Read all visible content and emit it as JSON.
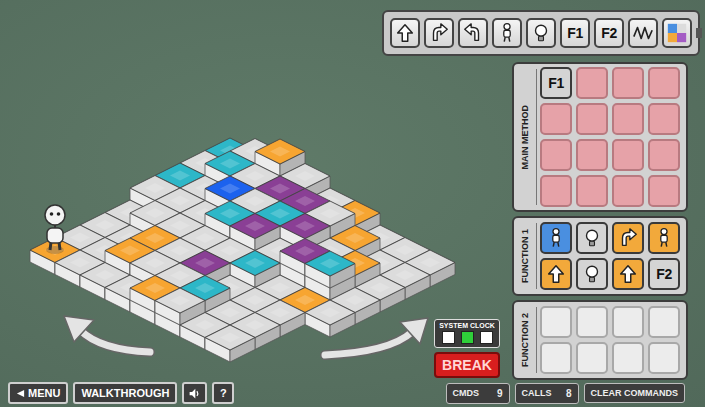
{
  "toolbar": [
    {
      "kind": "forward"
    },
    {
      "kind": "turn-right"
    },
    {
      "kind": "turn-left"
    },
    {
      "kind": "jump"
    },
    {
      "kind": "light"
    },
    {
      "kind": "call",
      "label": "F1"
    },
    {
      "kind": "call",
      "label": "F2"
    },
    {
      "kind": "zigzag"
    },
    {
      "kind": "colors"
    }
  ],
  "panels": [
    {
      "title": "MAIN METHOD",
      "kind": "main",
      "slots": [
        {
          "kind": "call",
          "label": "F1",
          "color": "#d4d4d4"
        },
        {
          "kind": "empty"
        },
        {
          "kind": "empty"
        },
        {
          "kind": "empty"
        },
        {
          "kind": "empty"
        },
        {
          "kind": "empty"
        },
        {
          "kind": "empty"
        },
        {
          "kind": "empty"
        },
        {
          "kind": "empty"
        },
        {
          "kind": "empty"
        },
        {
          "kind": "empty"
        },
        {
          "kind": "empty"
        },
        {
          "kind": "empty"
        },
        {
          "kind": "empty"
        },
        {
          "kind": "empty"
        },
        {
          "kind": "empty"
        }
      ]
    },
    {
      "title": "FUNCTION 1",
      "kind": "function",
      "slots": [
        {
          "kind": "jump",
          "color": "#4a8fe0"
        },
        {
          "kind": "light",
          "color": "#d4d4d4"
        },
        {
          "kind": "turn-right",
          "color": "#f2a93b"
        },
        {
          "kind": "jump",
          "color": "#f2a93b"
        },
        {
          "kind": "forward",
          "color": "#f2a93b"
        },
        {
          "kind": "light",
          "color": "#d4d4d4"
        },
        {
          "kind": "forward",
          "color": "#f2a93b"
        },
        {
          "kind": "call",
          "label": "F2",
          "color": "#d4d4d4"
        }
      ]
    },
    {
      "title": "FUNCTION 2",
      "kind": "function",
      "slots": [
        {
          "kind": "empty"
        },
        {
          "kind": "empty"
        },
        {
          "kind": "empty"
        },
        {
          "kind": "empty"
        },
        {
          "kind": "empty"
        },
        {
          "kind": "empty"
        },
        {
          "kind": "empty"
        },
        {
          "kind": "empty"
        }
      ]
    }
  ],
  "board": {
    "rows": [
      [
        {
          "h": 2,
          "color": "#2db7c8"
        },
        {
          "h": 3,
          "color": "#dcdcdc"
        },
        {
          "h": 4,
          "color": "#f7a531"
        },
        {
          "h": 3,
          "color": "#dcdcdc"
        },
        {
          "h": 2,
          "color": "#dcdcdc"
        },
        {
          "h": 2,
          "color": "#f7a531"
        },
        {
          "h": 1,
          "color": "#dcdcdc"
        },
        {
          "h": 1,
          "color": "#dcdcdc"
        },
        {
          "h": 1,
          "color": "#dcdcdc"
        }
      ],
      [
        {
          "h": 2,
          "color": "#dcdcdc"
        },
        {
          "h": 3,
          "color": "#2db7c8"
        },
        {
          "h": 3,
          "color": "#dcdcdc"
        },
        {
          "h": 3,
          "color": "#8a3f95"
        },
        {
          "h": 3,
          "color": "#8a3f95"
        },
        {
          "h": 3,
          "color": "#dcdcdc"
        },
        {
          "h": 2,
          "color": "#f7a531"
        },
        {
          "h": 1,
          "color": "#dcdcdc"
        },
        {
          "h": 1,
          "color": "#dcdcdc"
        }
      ],
      [
        {
          "h": 2,
          "color": "#2db7c8"
        },
        {
          "h": 2,
          "color": "#dcdcdc"
        },
        {
          "h": 3,
          "color": "#1c62ee"
        },
        {
          "h": 3,
          "color": "#dcdcdc"
        },
        {
          "h": 3,
          "color": "#2db7c8"
        },
        {
          "h": 3,
          "color": "#8a3f95"
        },
        {
          "h": 2,
          "color": "#dcdcdc"
        },
        {
          "h": 2,
          "color": "#f7a531"
        },
        {
          "h": 1,
          "color": "#dcdcdc"
        }
      ],
      [
        {
          "h": 2,
          "color": "#dcdcdc"
        },
        {
          "h": 2,
          "color": "#dcdcdc"
        },
        {
          "h": 2,
          "color": "#dcdcdc"
        },
        {
          "h": 3,
          "color": "#2db7c8"
        },
        {
          "h": 3,
          "color": "#8a3f95"
        },
        {
          "h": 2,
          "color": "#dcdcdc"
        },
        {
          "h": 3,
          "color": "#8a3f95"
        },
        {
          "h": 3,
          "color": "#2db7c8"
        },
        {
          "h": 1,
          "color": "#dcdcdc"
        }
      ],
      [
        {
          "h": 1,
          "color": "#dcdcdc"
        },
        {
          "h": 2,
          "color": "#dcdcdc"
        },
        {
          "h": 2,
          "color": "#dcdcdc"
        },
        {
          "h": 2,
          "color": "#dcdcdc"
        },
        {
          "h": 2,
          "color": "#dcdcdc"
        },
        {
          "h": 2,
          "color": "#2db7c8"
        },
        {
          "h": 1,
          "color": "#dcdcdc"
        },
        {
          "h": 1,
          "color": "#f7a531"
        },
        {
          "h": 1,
          "color": "#dcdcdc"
        }
      ],
      [
        {
          "h": 1,
          "color": "#dcdcdc"
        },
        {
          "h": 1,
          "color": "#dcdcdc"
        },
        {
          "h": 2,
          "color": "#f7a531"
        },
        {
          "h": 2,
          "color": "#dcdcdc"
        },
        {
          "h": 2,
          "color": "#8a3f95"
        },
        {
          "h": 1,
          "color": "#dcdcdc"
        },
        {
          "h": 1,
          "color": "#dcdcdc"
        },
        {
          "h": 1,
          "color": "#dcdcdc"
        }
      ],
      [
        {
          "h": 1,
          "color": "#dcdcdc"
        },
        {
          "h": 1,
          "color": "#dcdcdc"
        },
        {
          "h": 2,
          "color": "#f7a531"
        },
        {
          "h": 2,
          "color": "#dcdcdc"
        },
        {
          "h": 2,
          "color": "#dcdcdc"
        },
        {
          "h": 2,
          "color": "#2db7c8"
        },
        {
          "h": 1,
          "color": "#dcdcdc"
        },
        {
          "h": 1,
          "color": "#dcdcdc"
        }
      ],
      [
        {
          "h": 1,
          "color": "#f7a531"
        },
        {
          "h": 1,
          "color": "#dcdcdc"
        },
        {
          "h": 1,
          "color": "#dcdcdc"
        },
        {
          "h": 1,
          "color": "#dcdcdc"
        },
        {
          "h": 2,
          "color": "#f7a531"
        },
        {
          "h": 2,
          "color": "#dcdcdc"
        },
        {
          "h": 1,
          "color": "#dcdcdc"
        },
        {
          "h": 1,
          "color": "#dcdcdc"
        }
      ]
    ]
  },
  "robot": {
    "row": 7,
    "col": 0
  },
  "clock": {
    "label": "SYSTEM CLOCK",
    "lights": [
      {
        "on": false
      },
      {
        "on": true
      },
      {
        "on": false
      }
    ]
  },
  "break_button": "BREAK",
  "menu_button": "MENU",
  "walkthrough_button": "WALKTHROUGH",
  "help_button": "?",
  "counters": [
    {
      "label": "CMDS",
      "value": "9"
    },
    {
      "label": "CALLS",
      "value": "8"
    }
  ],
  "clear_button": "CLEAR COMMANDS"
}
